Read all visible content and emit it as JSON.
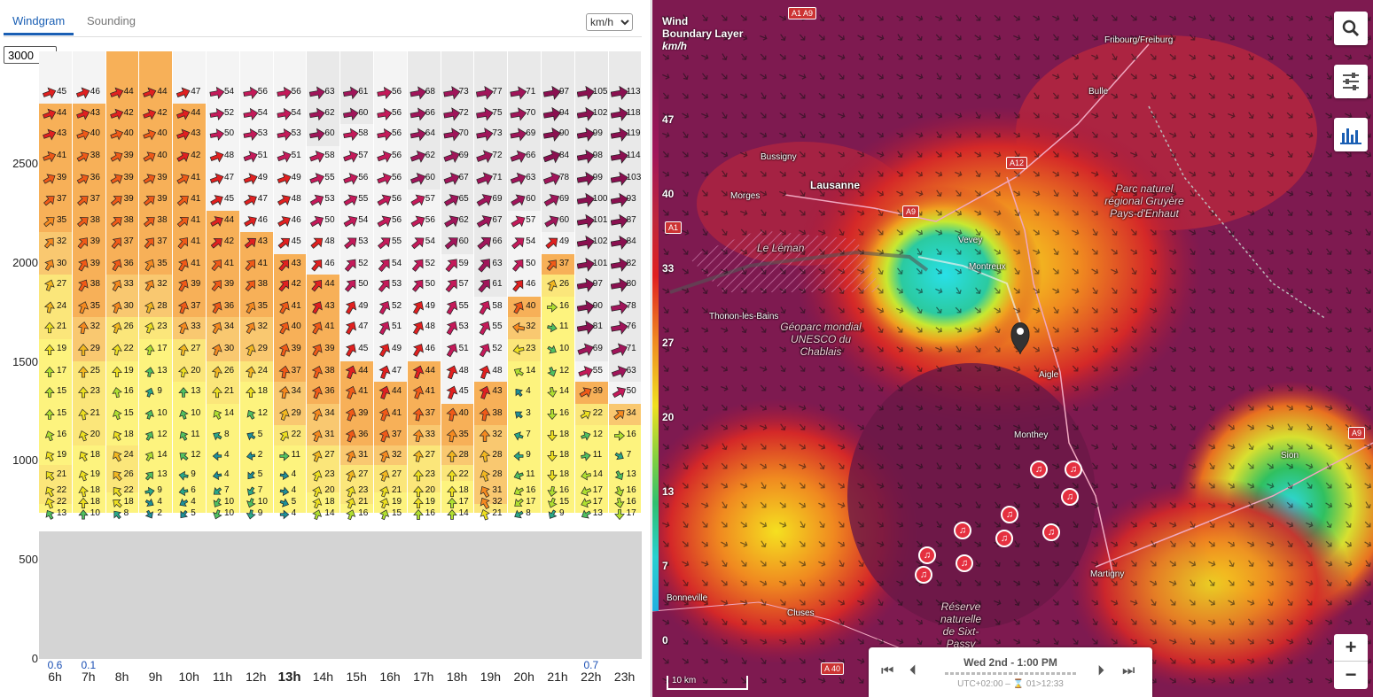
{
  "tabs": {
    "windgram": "Windgram",
    "sounding": "Sounding"
  },
  "unit_select": {
    "value": "km/h"
  },
  "altitude_select": {
    "value": "3000"
  },
  "y_axis": {
    "labels": [
      "2500",
      "2000",
      "1500",
      "1000",
      "500",
      "0"
    ],
    "max": 3000
  },
  "hours": [
    "6h",
    "7h",
    "8h",
    "9h",
    "10h",
    "11h",
    "12h",
    "13h",
    "14h",
    "15h",
    "16h",
    "17h",
    "18h",
    "19h",
    "20h",
    "21h",
    "22h",
    "23h"
  ],
  "current_hour": "13h",
  "precip": [
    "0.6",
    "0.1",
    "",
    "",
    "",
    "",
    "",
    "",
    "",
    "",
    "",
    "",
    "",
    "",
    "",
    "",
    "0.7",
    ""
  ],
  "levels": [
    2860,
    2755,
    2650,
    2540,
    2430,
    2320,
    2215,
    2105,
    1995,
    1890,
    1780,
    1675,
    1565,
    1455,
    1350,
    1240,
    1130,
    1030,
    930,
    850,
    790,
    735,
    695
  ],
  "columns": [
    {
      "speeds": [
        45,
        44,
        43,
        41,
        39,
        37,
        35,
        32,
        30,
        27,
        24,
        21,
        19,
        17,
        15,
        15,
        16,
        19,
        21,
        22,
        22,
        13
      ],
      "dir": [
        70,
        70,
        70,
        70,
        60,
        50,
        50,
        40,
        30,
        20,
        10,
        0,
        0,
        0,
        0,
        0,
        -20,
        -30,
        -40,
        -30,
        -20,
        -30
      ]
    },
    {
      "speeds": [
        46,
        43,
        40,
        38,
        36,
        37,
        38,
        39,
        39,
        38,
        35,
        32,
        29,
        25,
        23,
        21,
        20,
        18,
        19,
        18,
        18,
        10
      ],
      "dir": [
        70,
        70,
        70,
        60,
        60,
        50,
        50,
        40,
        30,
        30,
        20,
        10,
        0,
        0,
        0,
        -10,
        -20,
        -30,
        -20,
        -10,
        0,
        0
      ]
    },
    {
      "speeds": [
        44,
        42,
        40,
        39,
        39,
        39,
        38,
        37,
        36,
        33,
        30,
        26,
        22,
        19,
        16,
        15,
        18,
        24,
        26,
        22,
        18,
        8
      ],
      "dir": [
        70,
        70,
        70,
        60,
        60,
        50,
        50,
        40,
        30,
        30,
        20,
        20,
        10,
        0,
        -10,
        -20,
        -30,
        -30,
        -40,
        -40,
        -50,
        -40
      ]
    },
    {
      "speeds": [
        44,
        42,
        40,
        40,
        39,
        39,
        38,
        37,
        35,
        32,
        28,
        23,
        17,
        13,
        9,
        10,
        12,
        14,
        13,
        9,
        4,
        2
      ],
      "dir": [
        70,
        70,
        70,
        60,
        60,
        50,
        50,
        40,
        30,
        30,
        20,
        20,
        10,
        10,
        20,
        20,
        30,
        30,
        40,
        80,
        120,
        150
      ]
    },
    {
      "speeds": [
        47,
        44,
        43,
        42,
        41,
        41,
        41,
        41,
        41,
        39,
        37,
        33,
        27,
        20,
        13,
        10,
        11,
        12,
        9,
        6,
        4,
        5
      ],
      "dir": [
        70,
        70,
        70,
        60,
        60,
        50,
        50,
        40,
        30,
        30,
        20,
        20,
        10,
        10,
        0,
        -20,
        -30,
        -50,
        -80,
        -100,
        -120,
        -140
      ]
    },
    {
      "speeds": [
        54,
        52,
        50,
        48,
        47,
        45,
        44,
        42,
        41,
        39,
        36,
        34,
        30,
        26,
        21,
        14,
        8,
        4,
        4,
        7,
        10,
        10
      ],
      "dir": [
        80,
        80,
        80,
        70,
        70,
        60,
        60,
        50,
        40,
        40,
        30,
        30,
        20,
        10,
        0,
        -30,
        -60,
        -90,
        -100,
        -130,
        -150,
        -160
      ]
    },
    {
      "speeds": [
        56,
        54,
        53,
        51,
        49,
        47,
        46,
        43,
        41,
        38,
        35,
        32,
        29,
        24,
        18,
        12,
        5,
        2,
        5,
        7,
        10,
        9
      ],
      "dir": [
        80,
        80,
        80,
        70,
        70,
        60,
        60,
        50,
        40,
        40,
        30,
        30,
        20,
        10,
        0,
        -30,
        -60,
        -100,
        -140,
        -150,
        -160,
        -170
      ]
    },
    {
      "speeds": [
        56,
        54,
        53,
        51,
        49,
        48,
        46,
        45,
        43,
        42,
        41,
        40,
        39,
        37,
        34,
        29,
        22,
        11,
        4,
        4,
        5,
        4
      ],
      "dir": [
        80,
        80,
        80,
        70,
        70,
        60,
        60,
        50,
        40,
        40,
        30,
        30,
        20,
        10,
        10,
        20,
        30,
        90,
        100,
        100,
        110,
        90
      ]
    },
    {
      "speeds": [
        63,
        62,
        60,
        58,
        55,
        53,
        50,
        48,
        46,
        44,
        43,
        41,
        39,
        38,
        36,
        34,
        31,
        27,
        23,
        20,
        18,
        14
      ],
      "dir": [
        80,
        80,
        80,
        70,
        70,
        60,
        60,
        50,
        40,
        40,
        30,
        30,
        30,
        20,
        20,
        20,
        20,
        20,
        20,
        20,
        20,
        20
      ]
    },
    {
      "speeds": [
        61,
        60,
        58,
        57,
        56,
        55,
        54,
        53,
        52,
        50,
        49,
        47,
        45,
        44,
        41,
        39,
        36,
        31,
        27,
        23,
        21,
        16
      ],
      "dir": [
        80,
        80,
        80,
        70,
        70,
        60,
        60,
        50,
        40,
        40,
        30,
        30,
        30,
        20,
        20,
        20,
        20,
        20,
        20,
        20,
        20,
        20
      ]
    },
    {
      "speeds": [
        56,
        56,
        56,
        56,
        56,
        56,
        56,
        55,
        54,
        53,
        52,
        51,
        49,
        47,
        44,
        41,
        37,
        32,
        27,
        21,
        19,
        15
      ],
      "dir": [
        80,
        80,
        80,
        70,
        70,
        60,
        60,
        50,
        40,
        40,
        30,
        30,
        30,
        20,
        20,
        20,
        20,
        20,
        20,
        20,
        20,
        20
      ]
    },
    {
      "speeds": [
        68,
        66,
        64,
        62,
        60,
        57,
        56,
        54,
        52,
        50,
        49,
        48,
        46,
        44,
        41,
        37,
        33,
        27,
        23,
        20,
        19,
        16
      ],
      "dir": [
        80,
        80,
        80,
        70,
        70,
        60,
        60,
        50,
        40,
        40,
        30,
        30,
        30,
        20,
        20,
        10,
        10,
        10,
        0,
        0,
        0,
        0
      ]
    },
    {
      "speeds": [
        73,
        72,
        70,
        69,
        67,
        65,
        62,
        60,
        59,
        57,
        55,
        53,
        51,
        48,
        45,
        40,
        35,
        28,
        22,
        18,
        17,
        14
      ],
      "dir": [
        80,
        80,
        80,
        70,
        70,
        60,
        60,
        50,
        40,
        40,
        30,
        30,
        30,
        20,
        20,
        10,
        10,
        0,
        0,
        0,
        0,
        0
      ]
    },
    {
      "speeds": [
        77,
        75,
        73,
        72,
        71,
        69,
        67,
        66,
        63,
        61,
        58,
        55,
        52,
        48,
        43,
        38,
        32,
        28,
        28,
        31,
        32,
        21
      ],
      "dir": [
        80,
        80,
        80,
        70,
        70,
        60,
        60,
        50,
        40,
        40,
        30,
        30,
        30,
        20,
        20,
        10,
        0,
        -10,
        -20,
        -30,
        -30,
        -20
      ]
    },
    {
      "speeds": [
        71,
        70,
        69,
        66,
        63,
        60,
        57,
        54,
        50,
        46,
        40,
        32,
        23,
        14,
        4,
        3,
        7,
        9,
        11,
        16,
        17,
        8
      ],
      "dir": [
        80,
        80,
        80,
        70,
        70,
        60,
        60,
        50,
        40,
        40,
        30,
        -80,
        -100,
        -60,
        -40,
        -50,
        -70,
        -90,
        -110,
        -120,
        -130,
        -120
      ]
    },
    {
      "speeds": [
        97,
        94,
        90,
        84,
        78,
        69,
        60,
        49,
        37,
        26,
        16,
        11,
        10,
        12,
        14,
        16,
        18,
        18,
        18,
        16,
        15,
        9
      ],
      "dir": [
        80,
        80,
        80,
        70,
        70,
        60,
        60,
        50,
        40,
        20,
        90,
        100,
        120,
        160,
        170,
        180,
        180,
        180,
        180,
        -170,
        -160,
        -150
      ]
    },
    {
      "speeds": [
        105,
        102,
        99,
        98,
        99,
        100,
        101,
        102,
        101,
        97,
        90,
        81,
        69,
        55,
        39,
        22,
        12,
        11,
        14,
        17,
        17,
        13
      ],
      "dir": [
        80,
        80,
        80,
        80,
        80,
        80,
        80,
        80,
        80,
        80,
        80,
        80,
        70,
        70,
        60,
        60,
        70,
        80,
        -100,
        -110,
        -110,
        -120
      ]
    },
    {
      "speeds": [
        113,
        118,
        119,
        114,
        103,
        93,
        87,
        84,
        82,
        80,
        78,
        76,
        71,
        63,
        50,
        34,
        16,
        7,
        13,
        16,
        16,
        17
      ],
      "dir": [
        80,
        80,
        80,
        80,
        80,
        80,
        80,
        80,
        80,
        80,
        80,
        80,
        70,
        70,
        60,
        50,
        90,
        120,
        150,
        160,
        170,
        180
      ]
    }
  ],
  "map": {
    "legend_title": [
      "Wind",
      "Boundary Layer",
      "km/h"
    ],
    "legend_labels": [
      "47",
      "40",
      "33",
      "27",
      "20",
      "13",
      "7",
      "0"
    ],
    "time": "Wed 2nd - 1:00 PM",
    "utc": "UTC+02:00 – ⌛ 01>12:33",
    "scale": "10 km",
    "places": [
      {
        "name": "Lausanne",
        "cls": "big"
      },
      {
        "name": "Morges",
        "cls": ""
      },
      {
        "name": "Bussigny",
        "cls": ""
      },
      {
        "name": "Vevey",
        "cls": ""
      },
      {
        "name": "Montreux",
        "cls": ""
      },
      {
        "name": "Bulle",
        "cls": ""
      },
      {
        "name": "Fribourg/Freiburg",
        "cls": ""
      },
      {
        "name": "Thonon-les-Bains",
        "cls": ""
      },
      {
        "name": "Aigle",
        "cls": ""
      },
      {
        "name": "Monthey",
        "cls": ""
      },
      {
        "name": "Sion",
        "cls": ""
      },
      {
        "name": "Martigny",
        "cls": ""
      },
      {
        "name": "Bonneville",
        "cls": ""
      },
      {
        "name": "Cluses",
        "cls": ""
      }
    ],
    "region_labels": [
      "Le Léman",
      "Géoparc mondial UNESCO du Chablais",
      "Parc naturel régional Gruyère Pays-d'Enhaut",
      "Réserve naturelle de Sixt-Passy"
    ],
    "roads": [
      "A1 A9",
      "A12",
      "A9",
      "A1",
      "A9",
      "A 40"
    ]
  },
  "colors": {
    "accent": "#1a5fb4",
    "ground": "#d4d4d4"
  }
}
